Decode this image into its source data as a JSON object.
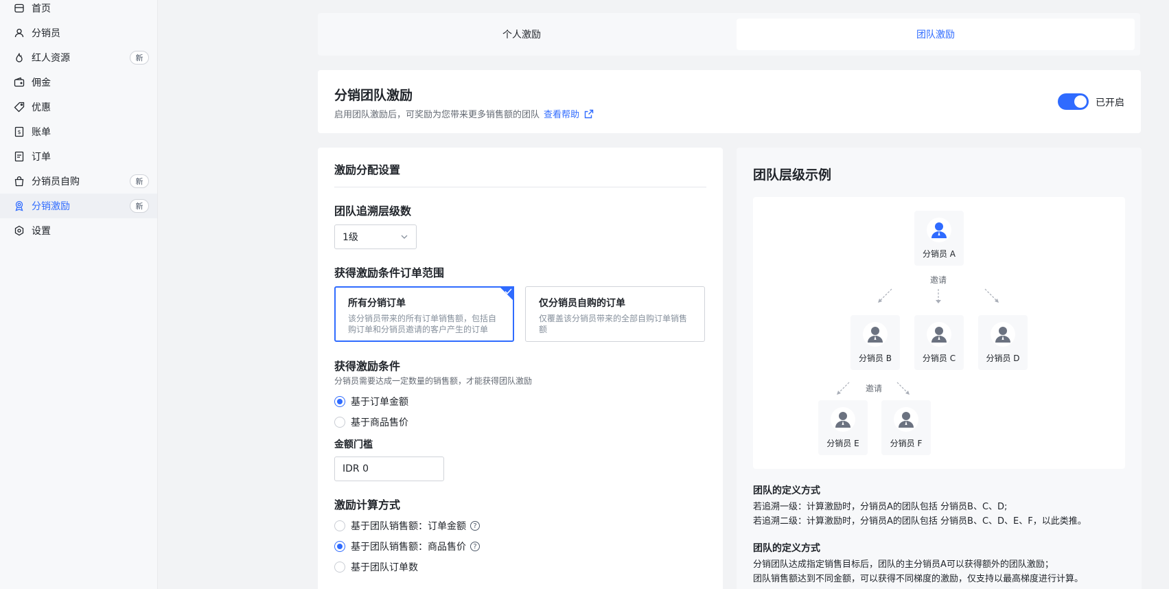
{
  "sidebar": {
    "items": [
      {
        "label": "首页",
        "icon": "store-icon",
        "badge": ""
      },
      {
        "label": "分销员",
        "icon": "user-icon",
        "badge": ""
      },
      {
        "label": "红人资源",
        "icon": "flame-icon",
        "badge": "新"
      },
      {
        "label": "佣金",
        "icon": "wallet-icon",
        "badge": ""
      },
      {
        "label": "优惠",
        "icon": "tag-icon",
        "badge": ""
      },
      {
        "label": "账单",
        "icon": "bill-icon",
        "badge": ""
      },
      {
        "label": "订单",
        "icon": "order-icon",
        "badge": ""
      },
      {
        "label": "分销员自购",
        "icon": "bag-icon",
        "badge": "新"
      },
      {
        "label": "分销激励",
        "icon": "award-icon",
        "badge": "新"
      },
      {
        "label": "设置",
        "icon": "settings-icon",
        "badge": ""
      }
    ]
  },
  "tabs": {
    "personal": "个人激励",
    "team": "团队激励"
  },
  "header": {
    "title": "分销团队激励",
    "desc": "启用团队激励后，可奖励为您带来更多销售额的团队",
    "help_link": "查看帮助",
    "toggle_label": "已开启"
  },
  "settings": {
    "title": "激励分配设置",
    "levels_label": "团队追溯层级数",
    "levels_value": "1级",
    "scope_label": "获得激励条件订单范围",
    "scope_options": [
      {
        "title": "所有分销订单",
        "desc": "该分销员带来的所有订单销售额，包括自购订单和分销员邀请的客户产生的订单"
      },
      {
        "title": "仅分销员自购的订单",
        "desc": "仅覆盖该分销员带来的全部自购订单销售额"
      }
    ],
    "condition_label": "获得激励条件",
    "condition_desc": "分销员需要达成一定数量的销售额，才能获得团队激励",
    "condition_options": [
      "基于订单金额",
      "基于商品售价"
    ],
    "threshold_label": "金额门槛",
    "threshold_value": "IDR 0",
    "calc_label": "激励计算方式",
    "calc_options": [
      "基于团队销售额：订单金额",
      "基于团队销售额：商品售价",
      "基于团队订单数"
    ]
  },
  "example": {
    "title": "团队层级示例",
    "invite": "邀请",
    "nodes": {
      "a": "分销员 A",
      "b": "分销员 B",
      "c": "分销员 C",
      "d": "分销员 D",
      "e": "分销员 E",
      "f": "分销员 F"
    },
    "def1_title": "团队的定义方式",
    "def1_lines": [
      "若追溯一级：计算激励时，分销员A的团队包括 分销员B、C、D;",
      "若追溯二级：计算激励时，分销员A的团队包括 分销员B、C、D、E、F，以此类推。"
    ],
    "def2_title": "团队的定义方式",
    "def2_lines": [
      "分销团队达成指定销售目标后，团队的主分销员A可以获得额外的团队激励；",
      "团队销售额达到不同金额，可以获得不同梯度的激励，仅支持以最高梯度进行计算。"
    ]
  },
  "colors": {
    "accent": "#2f6bff",
    "avatar": "#6b7280"
  }
}
